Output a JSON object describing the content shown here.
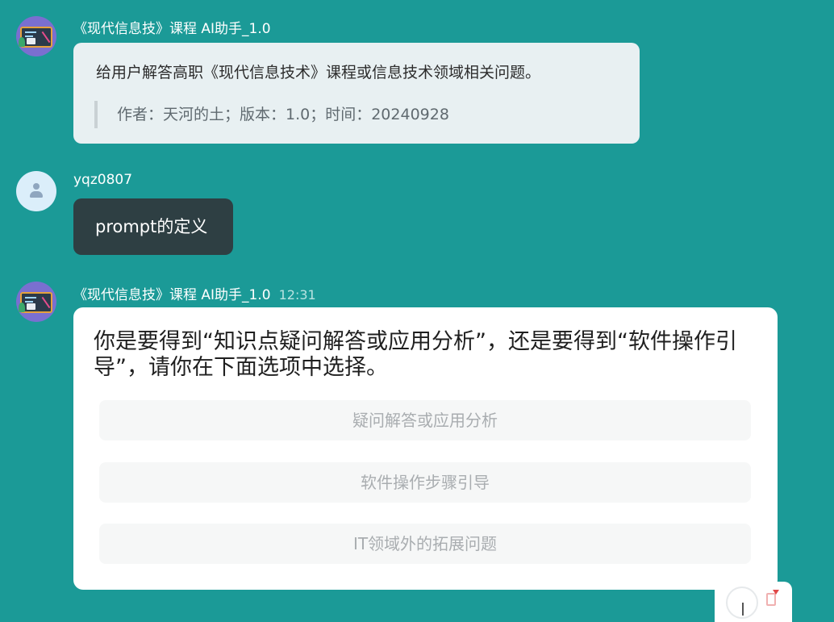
{
  "bot": {
    "name": "《现代信息技》课程 AI助手_1.0",
    "avatar_icon": "teacher-board-icon"
  },
  "intro": {
    "description": "给用户解答高职《现代信息技术》课程或信息技术领域相关问题。",
    "meta": "作者：天河的土；版本：1.0；时间：20240928"
  },
  "user": {
    "name": "yqz0807",
    "avatar_icon": "user-icon",
    "message": "prompt的定义"
  },
  "reply": {
    "time": "12:31",
    "question": "你是要得到“知识点疑问解答或应用分析”，还是要得到“软件操作引导”，请你在下面选项中选择。",
    "options": [
      "疑问解答或应用分析",
      "软件操作步骤引导",
      "IT领域外的拓展问题"
    ]
  },
  "colors": {
    "background": "#1b9a97",
    "user_bubble": "#2e3f43",
    "intro_bubble": "#e8f0f2",
    "option_bg": "#f6f7f7"
  }
}
